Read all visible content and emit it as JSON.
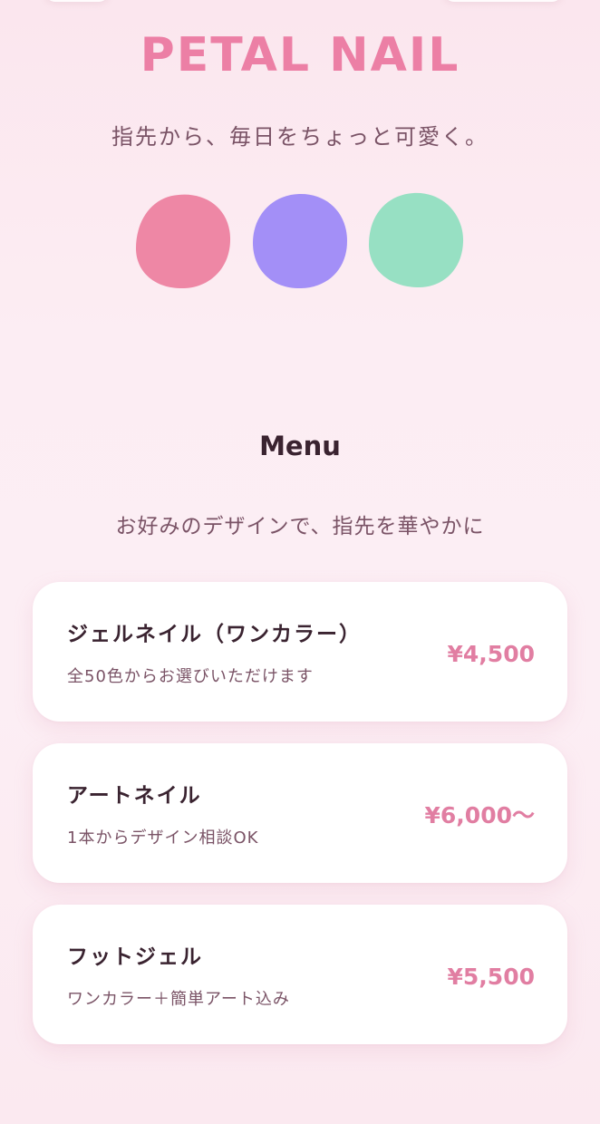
{
  "header": {
    "brand": "PETAL NAIL",
    "tagline": "指先から、毎日をちょっと可愛く。"
  },
  "swatches": [
    {
      "name": "pink",
      "color": "#ee87a5"
    },
    {
      "name": "purple",
      "color": "#a38ff7"
    },
    {
      "name": "mint",
      "color": "#97e0c3"
    }
  ],
  "menu": {
    "title": "Menu",
    "subtitle": "お好みのデザインで、指先を華やかに",
    "items": [
      {
        "name": "ジェルネイル（ワンカラー）",
        "description": "全50色からお選びいただけます",
        "price": "¥4,500"
      },
      {
        "name": "アートネイル",
        "description": "1本からデザイン相談OK",
        "price": "¥6,000〜"
      },
      {
        "name": "フットジェル",
        "description": "ワンカラー＋簡単アート込み",
        "price": "¥5,500"
      }
    ]
  },
  "colors": {
    "accent": "#ec7fa5",
    "price": "#e17ea2",
    "text": "#3a2330",
    "muted": "#7a5366",
    "background": "#fcedf3"
  }
}
